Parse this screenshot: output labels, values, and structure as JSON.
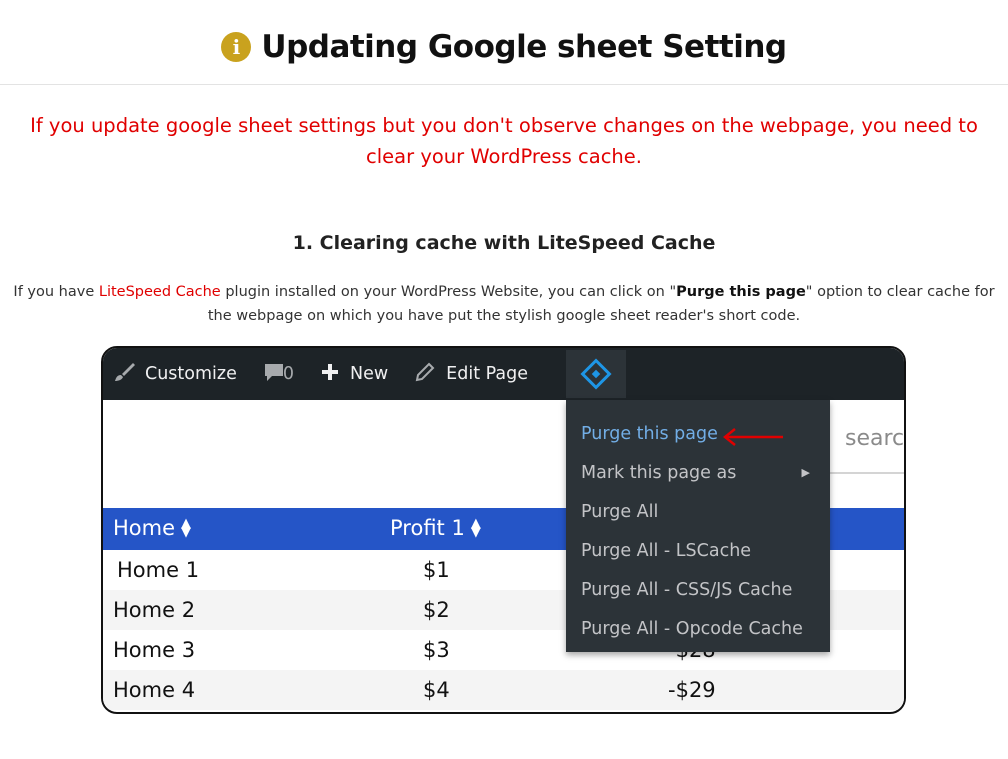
{
  "header": {
    "icon": "info-icon",
    "icon_color": "#c9a21e",
    "title": "Updating Google sheet Setting"
  },
  "warning": {
    "text": "If you update google sheet settings but you don't observe changes on the webpage, you need to clear your WordPress cache.",
    "color": "#e00000"
  },
  "section": {
    "title": "1. Clearing cache with LiteSpeed Cache",
    "desc_prefix": "If you have ",
    "desc_link": "LiteSpeed Cache",
    "desc_middle": " plugin installed on your WordPress Website, you can click on \"",
    "desc_bold": "Purge this page",
    "desc_suffix": "\" option to clear cache for the webpage on which you have put the stylish google sheet reader's short code."
  },
  "screenshot": {
    "adminbar": {
      "customize": "Customize",
      "comments_count": "0",
      "new": "New",
      "edit_page": "Edit Page",
      "bg_color": "#1d2327"
    },
    "search_placeholder": "searc",
    "table": {
      "header_color": "#2555c7",
      "columns": [
        "Home",
        "Profit 1",
        ""
      ],
      "rows": [
        [
          "Home 1",
          "$1",
          ""
        ],
        [
          "Home 2",
          "$2",
          ""
        ],
        [
          "Home 3",
          "$3",
          "-$28"
        ],
        [
          "Home 4",
          "$4",
          "-$29"
        ]
      ]
    },
    "dropdown": {
      "items": [
        "Purge this page",
        "Mark this page as",
        "Purge All",
        "Purge All - LSCache",
        "Purge All - CSS/JS Cache",
        "Purge All - Opcode Cache"
      ],
      "active_color": "#72aee6"
    }
  }
}
